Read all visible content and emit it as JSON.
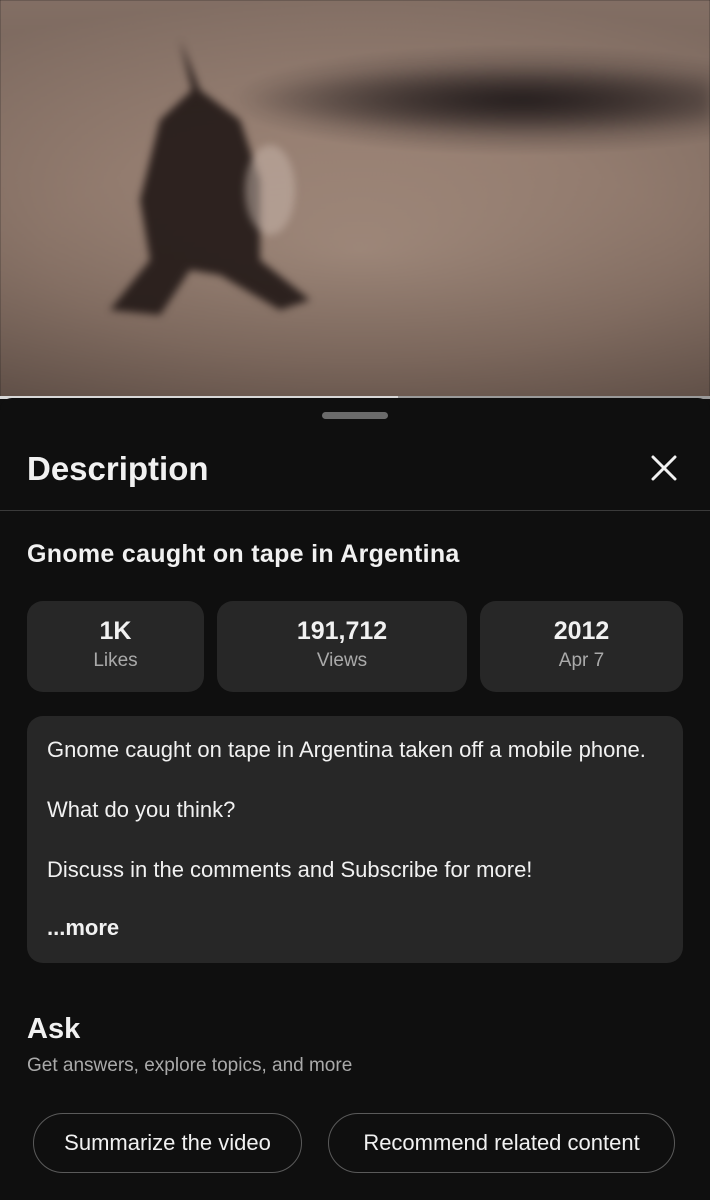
{
  "video": {
    "progress": 0.56
  },
  "sheet": {
    "title": "Description",
    "close_icon": "close-icon"
  },
  "video_title": "Gnome caught on tape in Argentina",
  "stats": [
    {
      "value": "1K",
      "label": "Likes"
    },
    {
      "value": "191,712",
      "label": "Views"
    },
    {
      "value": "2012",
      "label": "Apr 7"
    }
  ],
  "description": {
    "text": "Gnome caught on tape in Argentina taken off a mobile phone.\n\nWhat do you think?\n\nDiscuss in the comments and Subscribe for more!",
    "more_label": "...more"
  },
  "ask": {
    "title": "Ask",
    "subtitle": "Get answers, explore topics, and more",
    "chips": [
      "Summarize the video",
      "Recommend related content"
    ]
  },
  "colors": {
    "background": "#0f0f0f",
    "card": "#272727",
    "text_primary": "#f1f1f1",
    "text_secondary": "#aaaaaa"
  }
}
